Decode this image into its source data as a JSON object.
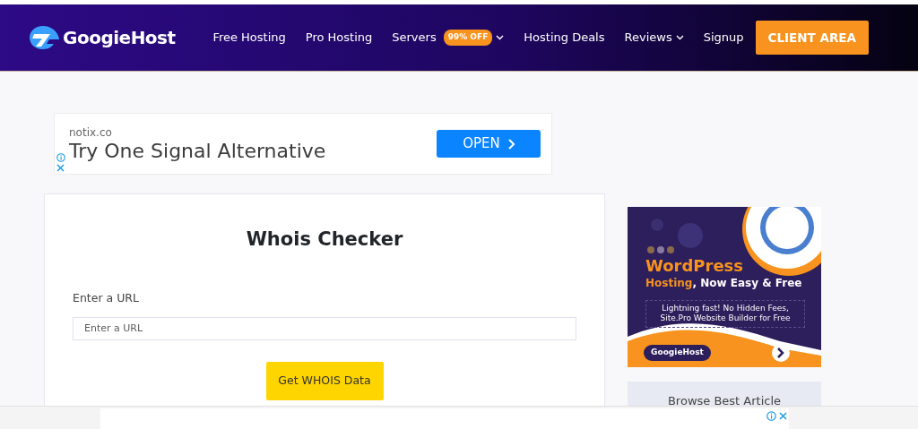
{
  "header": {
    "logo": "GoogieHost",
    "nav": [
      {
        "label": "Free Hosting",
        "dropdown": false
      },
      {
        "label": "Pro Hosting",
        "dropdown": false
      },
      {
        "label": "Servers",
        "badge": "99% OFF",
        "dropdown": true
      },
      {
        "label": "Hosting Deals",
        "dropdown": false
      },
      {
        "label": "Reviews",
        "dropdown": true
      },
      {
        "label": "Signup",
        "dropdown": false
      }
    ],
    "cta": "CLIENT AREA"
  },
  "top_ad": {
    "domain": "notix.co",
    "headline": "Try One Signal Alternative",
    "button": "OPEN"
  },
  "tool": {
    "title": "Whois Checker",
    "field_label": "Enter a URL",
    "placeholder": "Enter a URL",
    "button": "Get WHOIS Data"
  },
  "side_ad": {
    "title": "WordPress",
    "accent": "Hosting",
    "subtitle": ", Now Easy & Free",
    "body": "Lightning fast! No Hidden Fees, Site.Pro Website Builder for Free",
    "button": "GoogieHost"
  },
  "browse": {
    "title": "Browse Best Article"
  }
}
